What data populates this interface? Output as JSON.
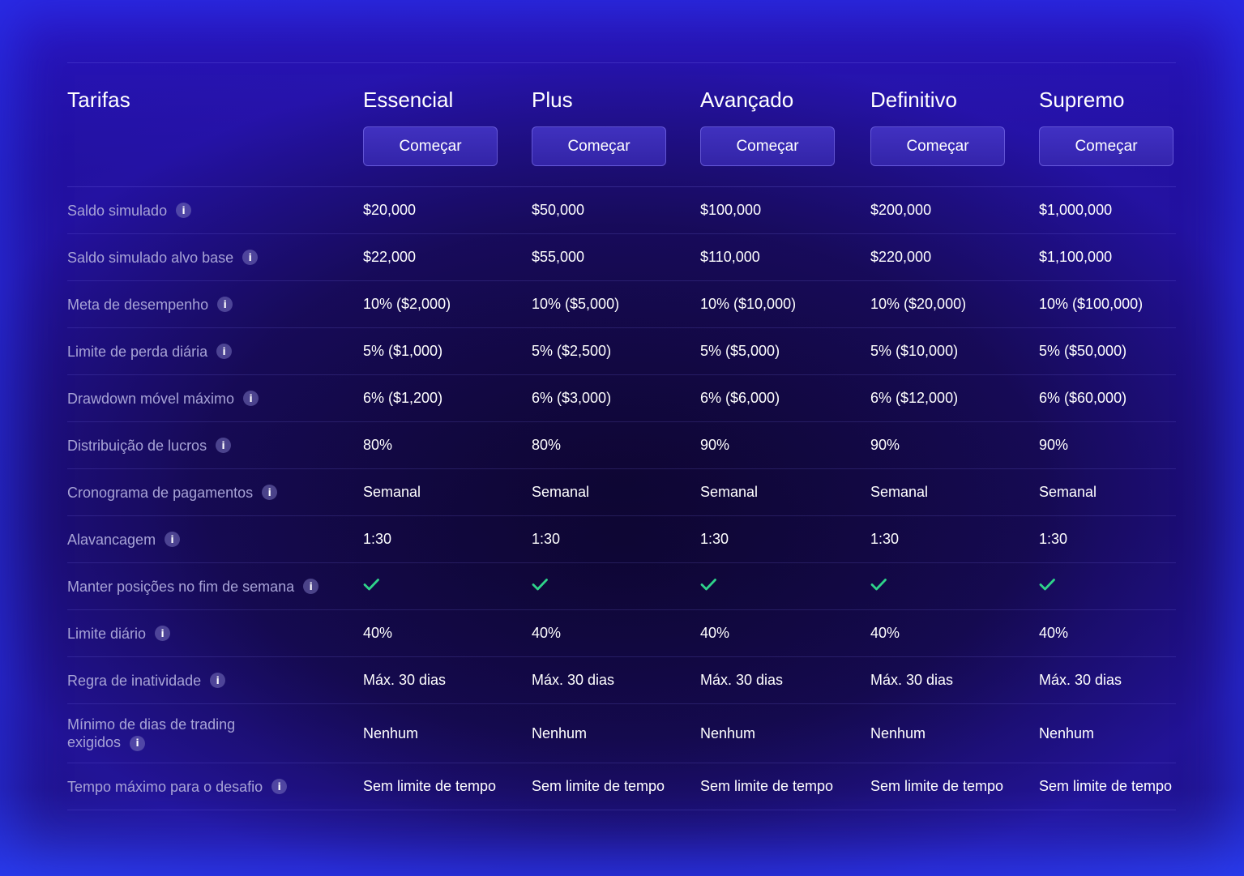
{
  "header": {
    "title": "Tarifas",
    "plans": [
      {
        "name": "Essencial",
        "button": "Começar"
      },
      {
        "name": "Plus",
        "button": "Começar"
      },
      {
        "name": "Avançado",
        "button": "Começar"
      },
      {
        "name": "Definitivo",
        "button": "Começar"
      },
      {
        "name": "Supremo",
        "button": "Começar"
      }
    ]
  },
  "colors": {
    "check": "#2fd48a",
    "label": "#a7a3d6",
    "button_bg": "#4a37c8"
  },
  "rows": [
    {
      "label": "Saldo simulado",
      "values": [
        "$20,000",
        "$50,000",
        "$100,000",
        "$200,000",
        "$1,000,000"
      ]
    },
    {
      "label": "Saldo simulado alvo base",
      "values": [
        "$22,000",
        "$55,000",
        "$110,000",
        "$220,000",
        "$1,100,000"
      ]
    },
    {
      "label": "Meta de desempenho",
      "values": [
        "10% ($2,000)",
        "10% ($5,000)",
        "10% ($10,000)",
        "10% ($20,000)",
        "10% ($100,000)"
      ]
    },
    {
      "label": "Limite de perda diária",
      "values": [
        "5% ($1,000)",
        "5% ($2,500)",
        "5% ($5,000)",
        "5% ($10,000)",
        "5% ($50,000)"
      ]
    },
    {
      "label": "Drawdown móvel máximo",
      "values": [
        "6% ($1,200)",
        "6% ($3,000)",
        "6% ($6,000)",
        "6% ($12,000)",
        "6% ($60,000)"
      ]
    },
    {
      "label": "Distribuição de lucros",
      "values": [
        "80%",
        "80%",
        "90%",
        "90%",
        "90%"
      ]
    },
    {
      "label": "Cronograma de pagamentos",
      "values": [
        "Semanal",
        "Semanal",
        "Semanal",
        "Semanal",
        "Semanal"
      ]
    },
    {
      "label": "Alavancagem",
      "values": [
        "1:30",
        "1:30",
        "1:30",
        "1:30",
        "1:30"
      ]
    },
    {
      "label": "Manter posições no fim de semana",
      "values": [
        "check-icon",
        "check-icon",
        "check-icon",
        "check-icon",
        "check-icon"
      ]
    },
    {
      "label": "Limite diário",
      "values": [
        "40%",
        "40%",
        "40%",
        "40%",
        "40%"
      ]
    },
    {
      "label": "Regra de inatividade",
      "values": [
        "Máx. 30 dias",
        "Máx. 30 dias",
        "Máx. 30 dias",
        "Máx. 30 dias",
        "Máx. 30 dias"
      ]
    },
    {
      "label": "Mínimo de dias de trading exigidos",
      "values": [
        "Nenhum",
        "Nenhum",
        "Nenhum",
        "Nenhum",
        "Nenhum"
      ]
    },
    {
      "label": "Tempo máximo para o desafio",
      "values": [
        "Sem limite de tempo",
        "Sem limite de tempo",
        "Sem limite de tempo",
        "Sem limite de tempo",
        "Sem limite de tempo"
      ]
    }
  ],
  "info_icon_glyph": "i"
}
